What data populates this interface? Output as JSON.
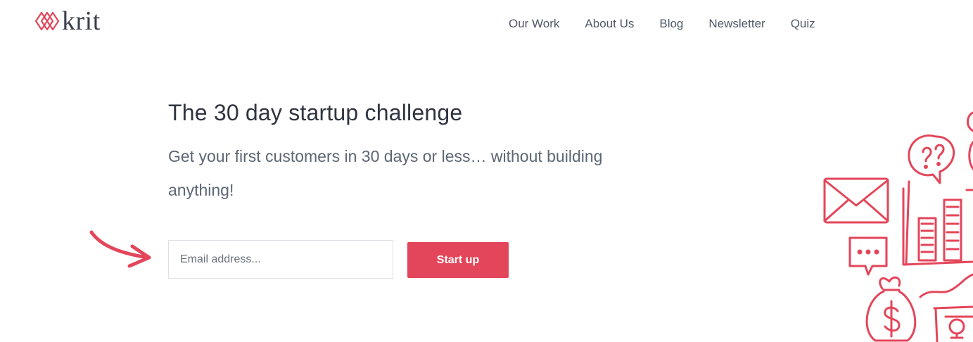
{
  "brand": {
    "name": "krit",
    "accent_color": "#e3465a",
    "logo_icon": "diamond-chain-icon"
  },
  "nav": {
    "items": [
      {
        "label": "Our Work"
      },
      {
        "label": "About Us"
      },
      {
        "label": "Blog"
      },
      {
        "label": "Newsletter"
      },
      {
        "label": "Quiz"
      }
    ]
  },
  "hero": {
    "title": "The 30 day startup challenge",
    "subtitle": "Get your first customers in 30 days or less… without building anything!",
    "email_placeholder": "Email address...",
    "cta_label": "Start up"
  },
  "decorations": {
    "arrow_icon": "hand-drawn-arrow-icon",
    "illustration_icons": [
      "envelope-icon",
      "question-bubble-icon",
      "bar-chart-icon",
      "chat-bubble-icon",
      "money-bag-icon",
      "trophy-icon"
    ]
  }
}
